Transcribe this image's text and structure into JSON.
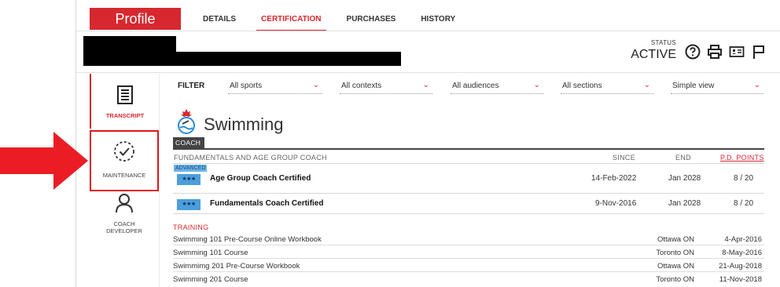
{
  "header": {
    "profile_label": "Profile",
    "tabs": [
      {
        "label": "DETAILS"
      },
      {
        "label": "CERTIFICATION"
      },
      {
        "label": "PURCHASES"
      },
      {
        "label": "HISTORY"
      }
    ],
    "active_tab": "CERTIFICATION",
    "status_label": "STATUS",
    "status_value": "ACTIVE",
    "icons": [
      "help-icon",
      "print-icon",
      "id-card-icon",
      "flag-icon"
    ]
  },
  "sidebar": {
    "items": [
      {
        "label": "TRANSCRIPT",
        "icon": "transcript-icon"
      },
      {
        "label": "MAINTENANCE",
        "icon": "maintenance-icon"
      },
      {
        "label": "COACH DEVELOPER",
        "icon": "coach-developer-icon"
      }
    ]
  },
  "filters": {
    "label": "FILTER",
    "selects": [
      {
        "value": "All sports"
      },
      {
        "value": "All contexts"
      },
      {
        "value": "All audiences"
      },
      {
        "value": "All sections"
      },
      {
        "value": "Simple view"
      }
    ]
  },
  "sport": {
    "title": "Swimming",
    "tag": "COACH",
    "context_header": "FUNDAMENTALS AND AGE GROUP COACH",
    "col_since": "SINCE",
    "col_end": "END",
    "col_pd": "P.D. POINTS",
    "certifications": [
      {
        "badge_top": "ADVANCED",
        "stars": "★★★",
        "name": "Age Group Coach Certified",
        "since": "14-Feb-2022",
        "end": "Jan 2028",
        "points": "8 / 20"
      },
      {
        "badge_top": "",
        "stars": "★★★",
        "name": "Fundamentals Coach Certified",
        "since": "9-Nov-2016",
        "end": "Jan 2028",
        "points": "8 / 20"
      }
    ]
  },
  "training": {
    "title": "TRAINING",
    "rows": [
      {
        "name": "Swimming 101 Pre-Course Online Workbook",
        "location": "Ottawa ON",
        "date": "4-Apr-2016"
      },
      {
        "name": "Swimming 101 Course",
        "location": "Toronto ON",
        "date": "8-May-2016"
      },
      {
        "name": "Swimmimg 201 Pre-Course Workbook",
        "location": "Ottawa ON",
        "date": "21-Aug-2018"
      },
      {
        "name": "Swimming 201 Course",
        "location": "Toronto ON",
        "date": "11-Nov-2018"
      }
    ]
  },
  "colors": {
    "accent": "#d7282f",
    "badge_blue": "#4a9fdc",
    "coach_tag": "#444444"
  }
}
